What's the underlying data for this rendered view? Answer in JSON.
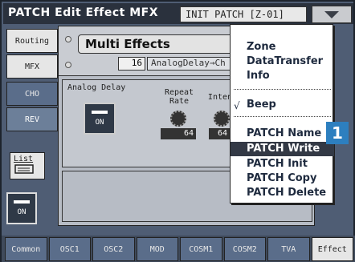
{
  "title": "PATCH Edit Effect MFX",
  "patch_display": "INIT PATCH   [Z-01]",
  "left_tabs": [
    "Routing",
    "MFX",
    "CHO",
    "REV"
  ],
  "mfx": {
    "name": "Multi Effects",
    "number": "16",
    "type": "AnalogDelay→Ch"
  },
  "section_label": "Analog Delay",
  "on_label": "ON",
  "params": [
    {
      "label": "Repeat\nRate",
      "value": "64"
    },
    {
      "label": "Intensi",
      "value": "64"
    }
  ],
  "list_label": "List",
  "bottom_tabs": [
    "Common",
    "OSC1",
    "OSC2",
    "MOD",
    "COSM1",
    "COSM2",
    "TVA",
    "Effect"
  ],
  "menu": {
    "group1": [
      "Zone",
      "DataTransfer",
      "Info"
    ],
    "check_item": "Beep",
    "check_mark": "√",
    "group2": [
      "PATCH Name",
      "PATCH Write",
      "PATCH Init",
      "PATCH Copy",
      "PATCH Delete"
    ],
    "selected_index": 1
  },
  "callout_number": "1",
  "colors": {
    "accent": "#2d7fbf",
    "selected_bg": "#333945",
    "tab_blue": "#5a6d8a"
  }
}
